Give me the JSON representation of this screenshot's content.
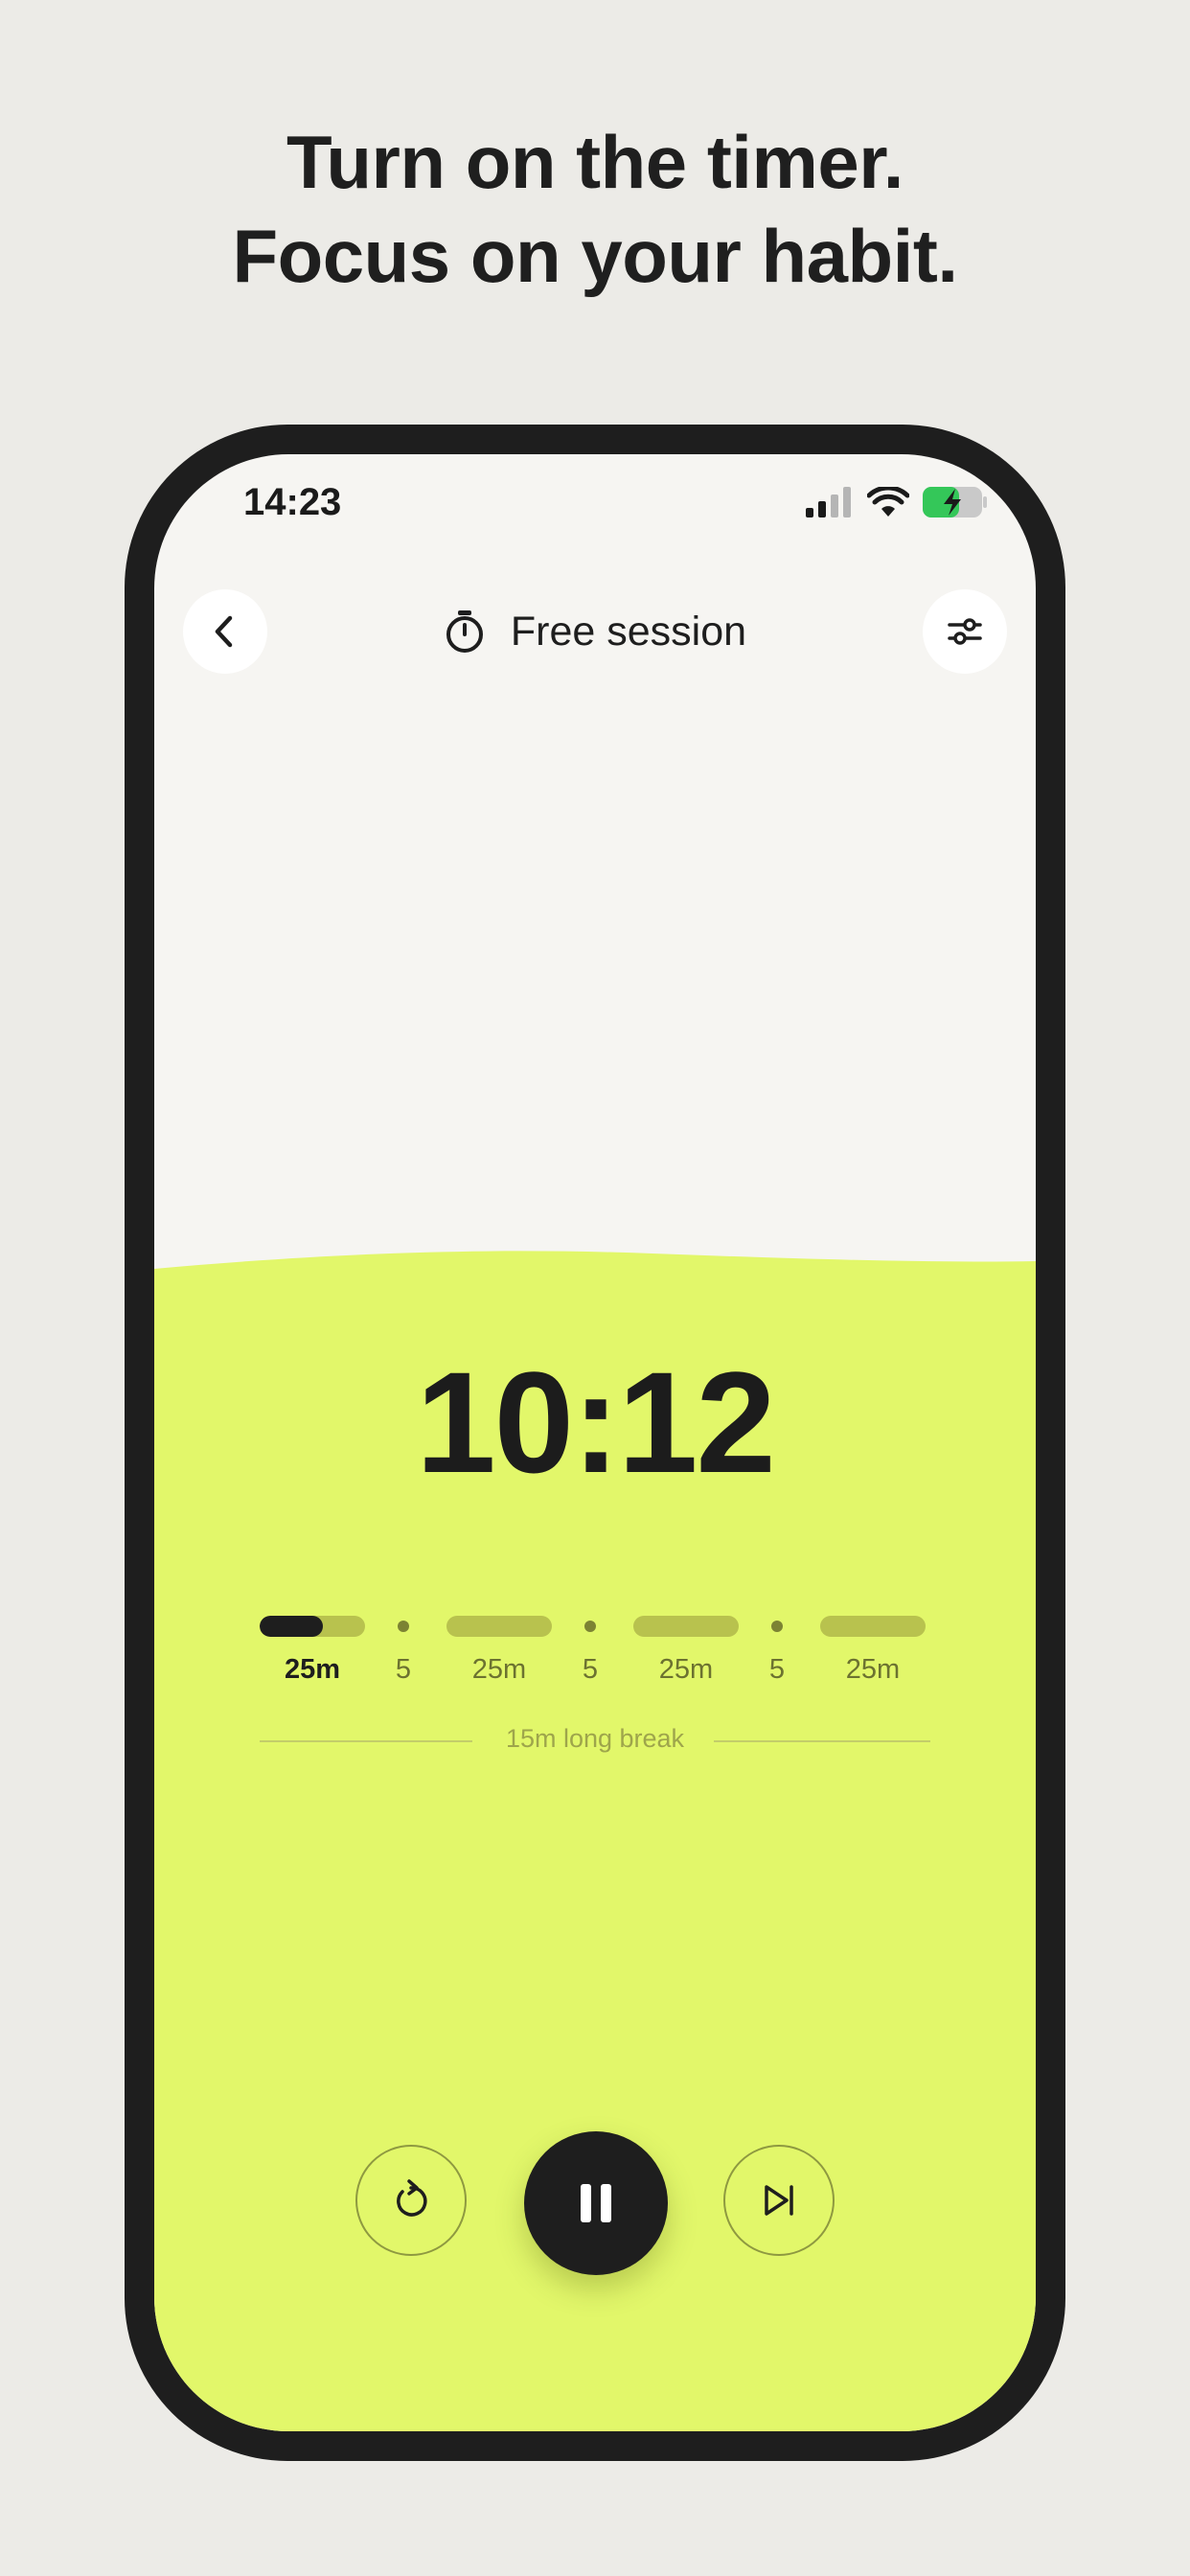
{
  "headline": {
    "line1": "Turn on the timer.",
    "line2": "Focus on your habit."
  },
  "status_bar": {
    "time": "14:23",
    "icons": [
      "cellular-signal-icon",
      "wifi-icon",
      "battery-charging-icon"
    ]
  },
  "header": {
    "title": "Free session",
    "icons": {
      "back": "chevron-left-icon",
      "title": "stopwatch-icon",
      "settings": "sliders-icon"
    }
  },
  "timer": {
    "time": "10:12"
  },
  "sessions": [
    {
      "label": "25m",
      "kind": "focus",
      "active": true,
      "progress": 0.6
    },
    {
      "label": "5",
      "kind": "break"
    },
    {
      "label": "25m",
      "kind": "focus"
    },
    {
      "label": "5",
      "kind": "break"
    },
    {
      "label": "25m",
      "kind": "focus"
    },
    {
      "label": "5",
      "kind": "break"
    },
    {
      "label": "25m",
      "kind": "focus"
    }
  ],
  "long_break": "15m long break",
  "controls": {
    "restart": "restart-icon",
    "pause": "pause-icon",
    "skip": "skip-forward-icon"
  },
  "colors": {
    "background": "#ecebe7",
    "phone_frame": "#1e1e1e",
    "screen_top": "#f6f5f2",
    "accent_lime": "#e2f76a",
    "segment_inactive": "#b8c24e",
    "text_dark": "#1e1e1e"
  }
}
